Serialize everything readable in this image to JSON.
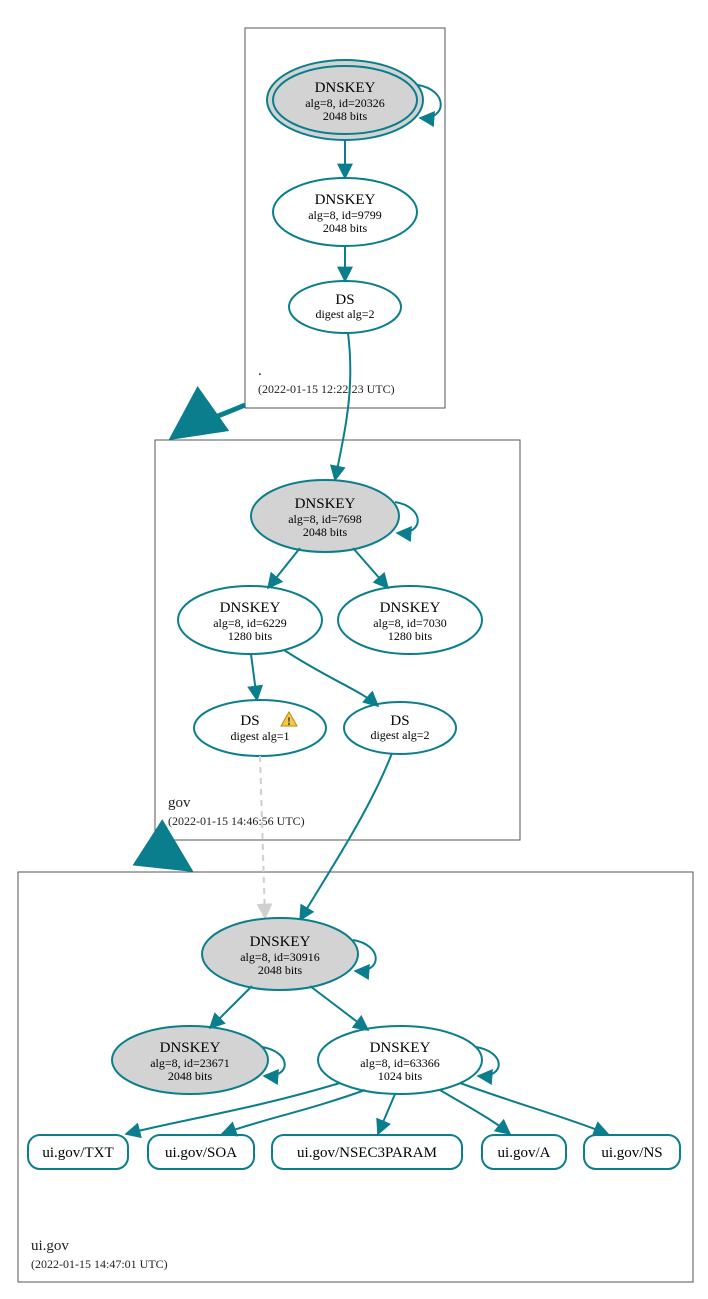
{
  "zones": {
    "root": {
      "name": ".",
      "ts": "(2022-01-15 12:22:23 UTC)"
    },
    "gov": {
      "name": "gov",
      "ts": "(2022-01-15 14:46:56 UTC)"
    },
    "uigov": {
      "name": "ui.gov",
      "ts": "(2022-01-15 14:47:01 UTC)"
    }
  },
  "nodes": {
    "root_ksk": {
      "l1": "DNSKEY",
      "l2": "alg=8, id=20326",
      "l3": "2048 bits"
    },
    "root_zsk": {
      "l1": "DNSKEY",
      "l2": "alg=8, id=9799",
      "l3": "2048 bits"
    },
    "root_ds": {
      "l1": "DS",
      "l2": "digest alg=2"
    },
    "gov_ksk": {
      "l1": "DNSKEY",
      "l2": "alg=8, id=7698",
      "l3": "2048 bits"
    },
    "gov_zsk1": {
      "l1": "DNSKEY",
      "l2": "alg=8, id=6229",
      "l3": "1280 bits"
    },
    "gov_zsk2": {
      "l1": "DNSKEY",
      "l2": "alg=8, id=7030",
      "l3": "1280 bits"
    },
    "gov_ds1": {
      "l1": "DS",
      "l2": "digest alg=1"
    },
    "gov_ds2": {
      "l1": "DS",
      "l2": "digest alg=2"
    },
    "ui_ksk": {
      "l1": "DNSKEY",
      "l2": "alg=8, id=30916",
      "l3": "2048 bits"
    },
    "ui_ksk2": {
      "l1": "DNSKEY",
      "l2": "alg=8, id=23671",
      "l3": "2048 bits"
    },
    "ui_zsk": {
      "l1": "DNSKEY",
      "l2": "alg=8, id=63366",
      "l3": "1024 bits"
    }
  },
  "rr": {
    "txt": "ui.gov/TXT",
    "soa": "ui.gov/SOA",
    "nsec": "ui.gov/NSEC3PARAM",
    "a": "ui.gov/A",
    "ns": "ui.gov/NS"
  },
  "colors": {
    "stroke": "#0a7e8c"
  }
}
